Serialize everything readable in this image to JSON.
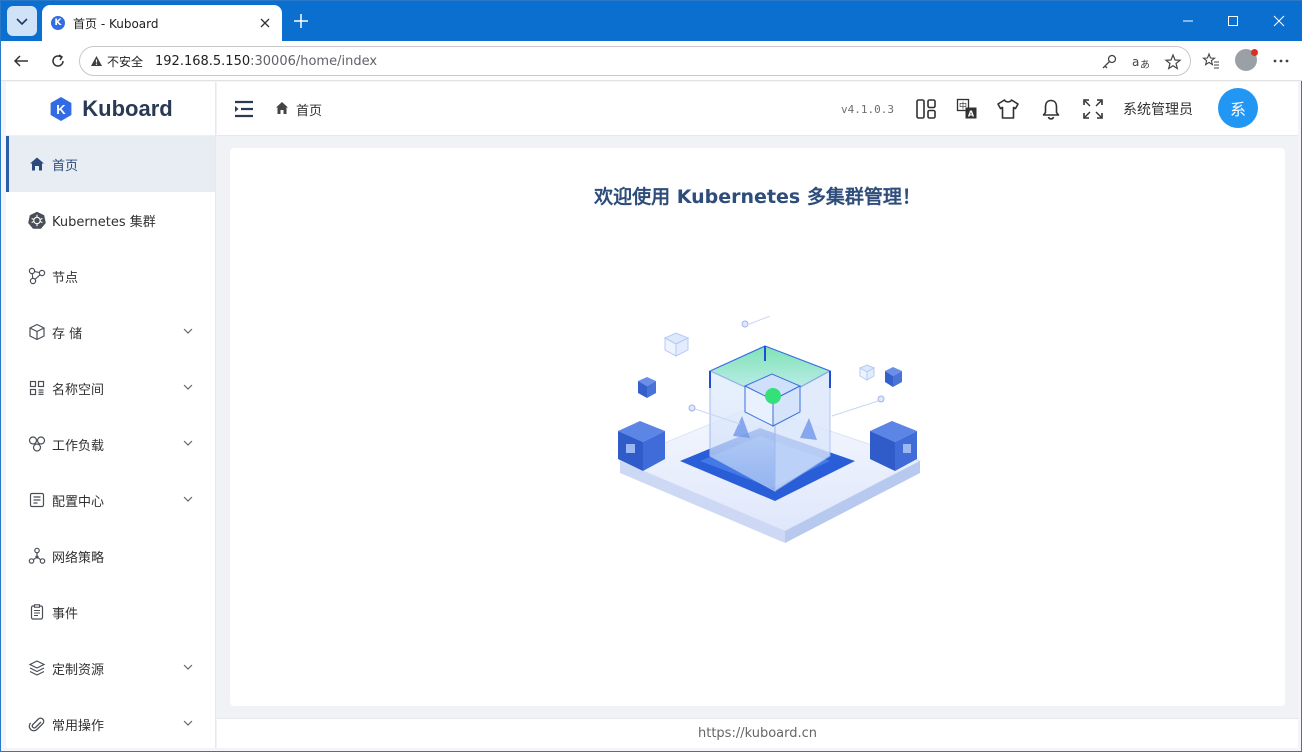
{
  "browser": {
    "tab_title": "首页 - Kuboard",
    "tab_favicon_letter": "K",
    "insecure_label": "不安全",
    "url_host": "192.168.5.150",
    "url_path": ":30006/home/index"
  },
  "app": {
    "logo_letter": "K",
    "logo_text": "Kuboard",
    "version": "v4.1.0.3",
    "username": "系统管理员",
    "avatar_text": "系",
    "breadcrumb": "首页",
    "welcome_title": "欢迎使用 Kubernetes 多集群管理！",
    "footer_link": "https://kuboard.cn",
    "accent_color": "#2196f3"
  },
  "sidebar": {
    "items": [
      {
        "label": "首页",
        "icon": "home-icon",
        "active": true,
        "expandable": false
      },
      {
        "label": "Kubernetes 集群",
        "icon": "kubernetes-icon",
        "active": false,
        "expandable": false
      },
      {
        "label": "节点",
        "icon": "node-icon",
        "active": false,
        "expandable": false
      },
      {
        "label": "存 储",
        "icon": "storage-cube-icon",
        "active": false,
        "expandable": true
      },
      {
        "label": "名称空间",
        "icon": "namespace-grid-icon",
        "active": false,
        "expandable": true
      },
      {
        "label": "工作负载",
        "icon": "workload-icon",
        "active": false,
        "expandable": true
      },
      {
        "label": "配置中心",
        "icon": "config-icon",
        "active": false,
        "expandable": true
      },
      {
        "label": "网络策略",
        "icon": "network-icon",
        "active": false,
        "expandable": false
      },
      {
        "label": "事件",
        "icon": "event-icon",
        "active": false,
        "expandable": false
      },
      {
        "label": "定制资源",
        "icon": "layers-icon",
        "active": false,
        "expandable": true
      },
      {
        "label": "常用操作",
        "icon": "paperclip-icon",
        "active": false,
        "expandable": true
      }
    ]
  }
}
